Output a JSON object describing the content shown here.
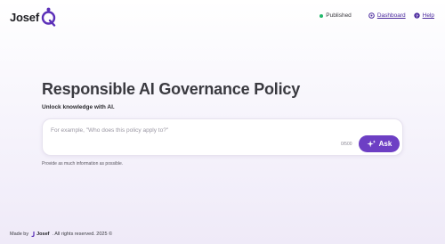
{
  "brand": {
    "name": "Josef",
    "accent": "#6d3fc4"
  },
  "nav": {
    "status_label": "Published",
    "status_color": "#22b86b",
    "dashboard_label": "Dashboard",
    "dashboard_icon": "dashboard-icon",
    "help_label": "Help",
    "help_icon": "help-icon"
  },
  "hero": {
    "title": "Responsible AI Governance Policy",
    "subtitle": "Unlock knowledge with AI."
  },
  "ask": {
    "placeholder": "For example, \"Who does this policy apply to?\"",
    "value": "",
    "counter": "0/500",
    "button_label": "Ask",
    "button_icon": "sparkle-icon"
  },
  "hint": "Provide as much information as possible.",
  "footer": {
    "made_by": "Made by",
    "logo_text": "Josef",
    "rights": ". All rights reserved. 2025 ©"
  }
}
